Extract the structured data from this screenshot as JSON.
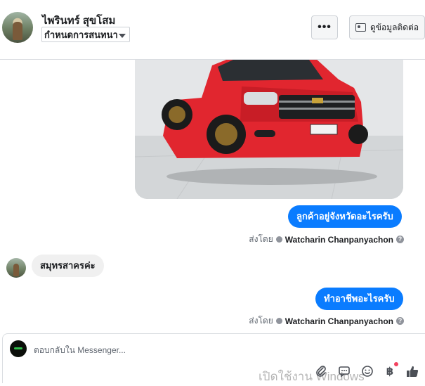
{
  "header": {
    "contact_name": "ไพรินทร์ สุขโสม",
    "conversation_select": "กำหนดการสนทนา",
    "more_button": "•••",
    "contact_info_button": "ดูข้อมูลติดต่อ"
  },
  "thread": {
    "messages": [
      {
        "direction": "outgoing",
        "text": "ลูกค้าอยู่จังหวัดอะไรครับ"
      },
      {
        "direction": "incoming",
        "text": "สมุทรสาครค่ะ"
      },
      {
        "direction": "outgoing",
        "text": "ทำอาชีพอะไรครับ"
      }
    ],
    "sent_by_label": "ส่งโดย",
    "sender_name": "Watcharin Chanpanyachon",
    "help_glyph": "?"
  },
  "composer": {
    "placeholder": "ตอบกลับใน Messenger...",
    "tools": [
      "paperclip-icon",
      "chat-bubble-icon",
      "emoji-icon",
      "baht-icon",
      "like-icon"
    ],
    "baht_glyph": "฿"
  },
  "watermark": "เปิดใช้งาน Windows",
  "colors": {
    "outgoing_bubble": "#0a7cff",
    "incoming_bubble": "#f0f0f0",
    "car_body": "#e1262f"
  }
}
